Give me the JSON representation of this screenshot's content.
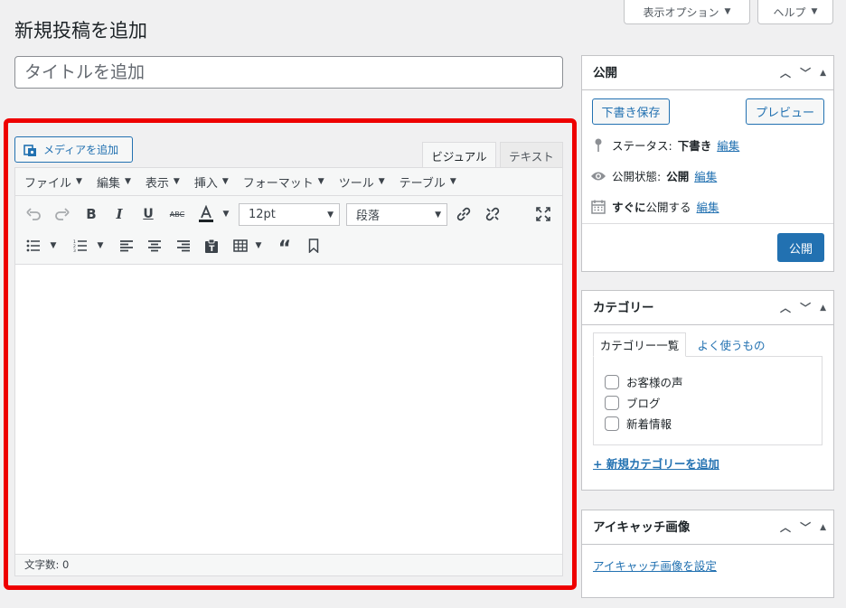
{
  "screen_options": {
    "label": "表示オプション",
    "help": "ヘルプ"
  },
  "page_title": "新規投稿を追加",
  "title_field": {
    "placeholder": "タイトルを追加",
    "value": ""
  },
  "editor": {
    "add_media": "メディアを追加",
    "tabs": {
      "visual": "ビジュアル",
      "text": "テキスト"
    },
    "menus": [
      "ファイル",
      "編集",
      "表示",
      "挿入",
      "フォーマット",
      "ツール",
      "テーブル"
    ],
    "font_size": "12pt",
    "block_format": "段落",
    "word_count": "文字数: 0"
  },
  "publish_box": {
    "title": "公開",
    "save_draft": "下書き保存",
    "preview": "プレビュー",
    "status_label": "ステータス:",
    "status_value": "下書き",
    "visibility_label": "公開状態:",
    "visibility_value": "公開",
    "schedule_bold": "すぐに",
    "schedule_rest": "公開する",
    "edit": "編集",
    "publish": "公開"
  },
  "category_box": {
    "title": "カテゴリー",
    "tab_all": "カテゴリー一覧",
    "tab_popular": "よく使うもの",
    "items": [
      "お客様の声",
      "ブログ",
      "新着情報"
    ],
    "add_new": "+ 新規カテゴリーを追加"
  },
  "featured_box": {
    "title": "アイキャッチ画像",
    "set_link": "アイキャッチ画像を設定"
  },
  "colors": {
    "accent": "#2271b1",
    "highlight": "#ee0000"
  }
}
